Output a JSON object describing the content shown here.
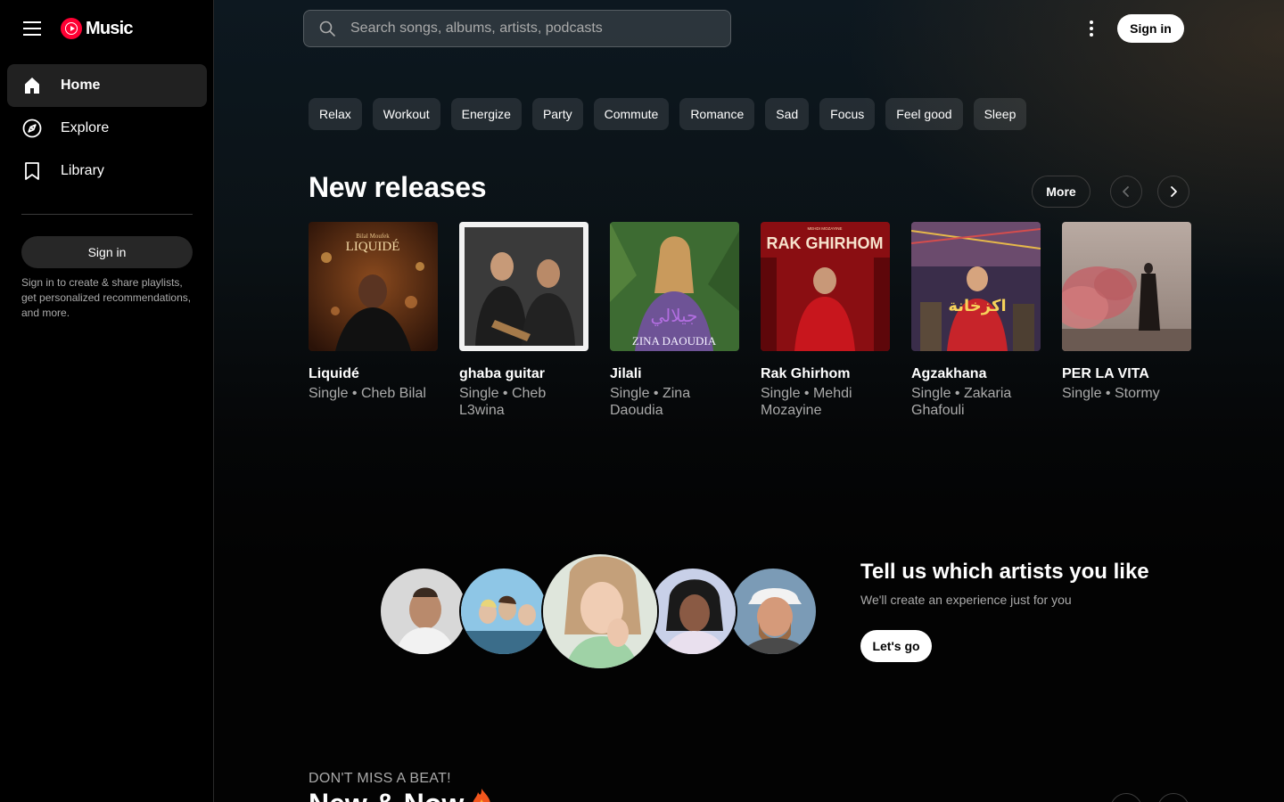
{
  "app": {
    "name": "Music"
  },
  "sidebar": {
    "items": [
      {
        "label": "Home",
        "icon": "home-icon",
        "active": true
      },
      {
        "label": "Explore",
        "icon": "compass-icon",
        "active": false
      },
      {
        "label": "Library",
        "icon": "bookmark-icon",
        "active": false
      }
    ],
    "signin_label": "Sign in",
    "note": "Sign in to create & share playlists, get personalized recommendations, and more."
  },
  "header": {
    "search_placeholder": "Search songs, albums, artists, podcasts",
    "signin_label": "Sign in"
  },
  "moods": [
    "Relax",
    "Workout",
    "Energize",
    "Party",
    "Commute",
    "Romance",
    "Sad",
    "Focus",
    "Feel good",
    "Sleep"
  ],
  "new_releases": {
    "title": "New releases",
    "more_label": "More",
    "items": [
      {
        "title": "Liquidé",
        "subtitle": "Single • Cheb Bilal",
        "cover_text": "LIQUIDÉ",
        "cover_small": "Bilal Moufek"
      },
      {
        "title": "ghaba guitar",
        "subtitle": "Single • Cheb L3wina",
        "cover_text": "",
        "cover_small": ""
      },
      {
        "title": "Jilali",
        "subtitle": "Single • Zina Daoudia",
        "cover_text": "ZINA DAOUDIA",
        "cover_small": "جيلالي"
      },
      {
        "title": "Rak Ghirhom",
        "subtitle": "Single • Mehdi Mozayine",
        "cover_text": "RAK GHIRHOM",
        "cover_small": "MEHDI MOZAYINE"
      },
      {
        "title": "Agzakhana",
        "subtitle": "Single • Zakaria Ghafouli",
        "cover_text": "اكزخانة",
        "cover_small": ""
      },
      {
        "title": "PER LA VITA",
        "subtitle": "Single • Stormy",
        "cover_text": "",
        "cover_small": ""
      }
    ]
  },
  "artist_promo": {
    "title": "Tell us which artists you like",
    "subtitle": "We'll create an experience just for you",
    "button_label": "Let's go"
  },
  "next_section": {
    "kicker": "DON'T MISS A BEAT!",
    "title": "New & Now"
  },
  "colors": {
    "accent": "#ff0033",
    "background": "#030303",
    "secondary_text": "#aaaaaa"
  }
}
